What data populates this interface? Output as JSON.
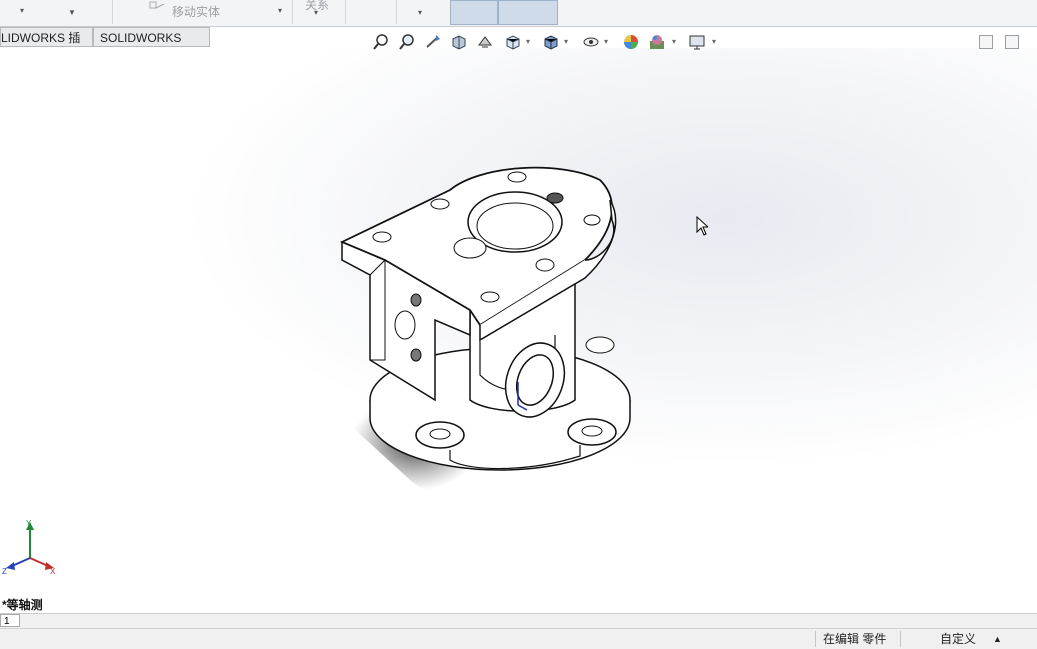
{
  "ribbon": {
    "move_body_label": "移动实体",
    "relations_label": "关系"
  },
  "tabs": [
    {
      "label": "LIDWORKS 插件"
    },
    {
      "label": "SOLIDWORKS MBD"
    }
  ],
  "heads_up_toolbar": {
    "icons": [
      "zoom-to-fit-icon",
      "zoom-area-icon",
      "previous-view-icon",
      "section-view-icon",
      "dynamic-annotation-icon",
      "view-orientation-icon",
      "display-style-icon",
      "hide-show-items-icon",
      "edit-appearance-icon",
      "apply-scene-icon",
      "view-settings-icon"
    ]
  },
  "viewport": {
    "view_name": "*等轴测",
    "triad_labels": {
      "x": "X",
      "y": "Y",
      "z": "Z"
    }
  },
  "sheet_tabs": [
    {
      "label": "1"
    }
  ],
  "status_bar": {
    "editing_label": "在编辑 零件",
    "units_label": "自定义",
    "units_arrow": "▲"
  }
}
